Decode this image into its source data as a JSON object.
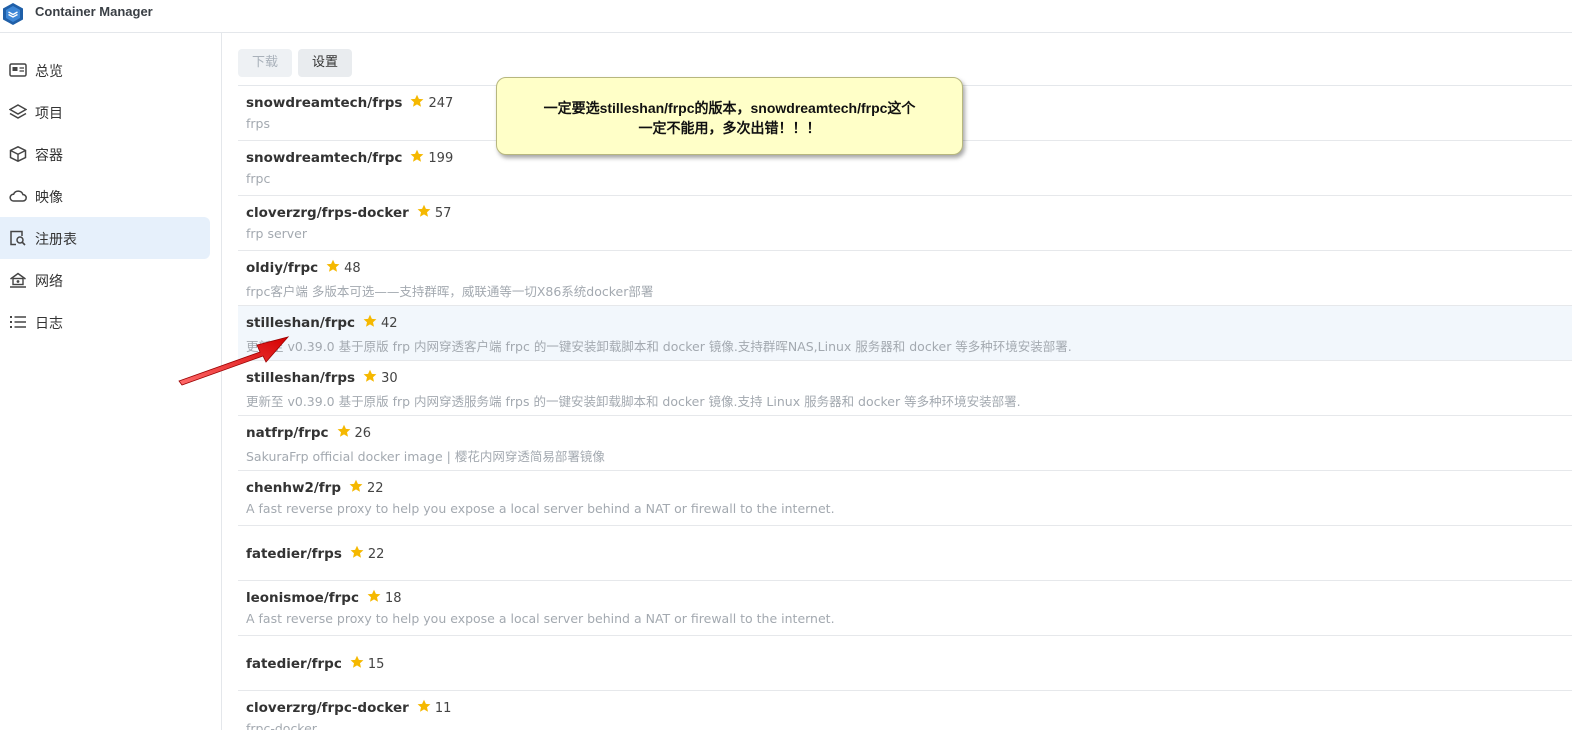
{
  "app": {
    "title": "Container Manager",
    "logo_icon": "container-manager-logo-icon"
  },
  "sidebar": {
    "items": [
      {
        "label": "总览",
        "icon": "overview-card-icon",
        "active": false
      },
      {
        "label": "项目",
        "icon": "project-layers-icon",
        "active": false
      },
      {
        "label": "容器",
        "icon": "container-box-icon",
        "active": false
      },
      {
        "label": "映像",
        "icon": "image-cloud-icon",
        "active": false
      },
      {
        "label": "注册表",
        "icon": "registry-search-icon",
        "active": true
      },
      {
        "label": "网络",
        "icon": "network-house-icon",
        "active": false
      },
      {
        "label": "日志",
        "icon": "log-list-icon",
        "active": false
      }
    ]
  },
  "toolbar": {
    "download_label": "下载",
    "settings_label": "设置"
  },
  "callout": {
    "line1": "一定要选stilleshan/frpc的版本，snowdreamtech/frpc这个",
    "line2": "一定不能用，多次出错！！！"
  },
  "repos": [
    {
      "name": "snowdreamtech/frps",
      "stars": "247",
      "desc": "frps"
    },
    {
      "name": "snowdreamtech/frpc",
      "stars": "199",
      "desc": "frpc"
    },
    {
      "name": "cloverzrg/frps-docker",
      "stars": "57",
      "desc": "frp server"
    },
    {
      "name": "oldiy/frpc",
      "stars": "48",
      "desc": "frpc客户端 多版本可选——支持群晖，威联通等一切X86系统docker部署"
    },
    {
      "name": "stilleshan/frpc",
      "stars": "42",
      "desc": "更新至 v0.39.0 基于原版 frp 内网穿透客户端 frpc 的一键安装卸载脚本和 docker 镜像.支持群晖NAS,Linux 服务器和 docker 等多种环境安装部署."
    },
    {
      "name": "stilleshan/frps",
      "stars": "30",
      "desc": "更新至 v0.39.0 基于原版 frp 内网穿透服务端 frps 的一键安装卸载脚本和 docker 镜像.支持 Linux 服务器和 docker 等多种环境安装部署."
    },
    {
      "name": "natfrp/frpc",
      "stars": "26",
      "desc": "SakuraFrp official docker image | 樱花内网穿透简易部署镜像"
    },
    {
      "name": "chenhw2/frp",
      "stars": "22",
      "desc": "A fast reverse proxy to help you expose a local server behind a NAT or firewall to the internet."
    },
    {
      "name": "fatedier/frps",
      "stars": "22",
      "desc": ""
    },
    {
      "name": "leonismoe/frpc",
      "stars": "18",
      "desc": "A fast reverse proxy to help you expose a local server behind a NAT or firewall to the internet."
    },
    {
      "name": "fatedier/frpc",
      "stars": "15",
      "desc": ""
    },
    {
      "name": "cloverzrg/frpc-docker",
      "stars": "11",
      "desc": "frpc-docker"
    }
  ],
  "colors": {
    "accent": "#e6f0fb",
    "star": "#f5b800",
    "arrow": "#e8161b",
    "callout_bg": "#ffffc8"
  }
}
